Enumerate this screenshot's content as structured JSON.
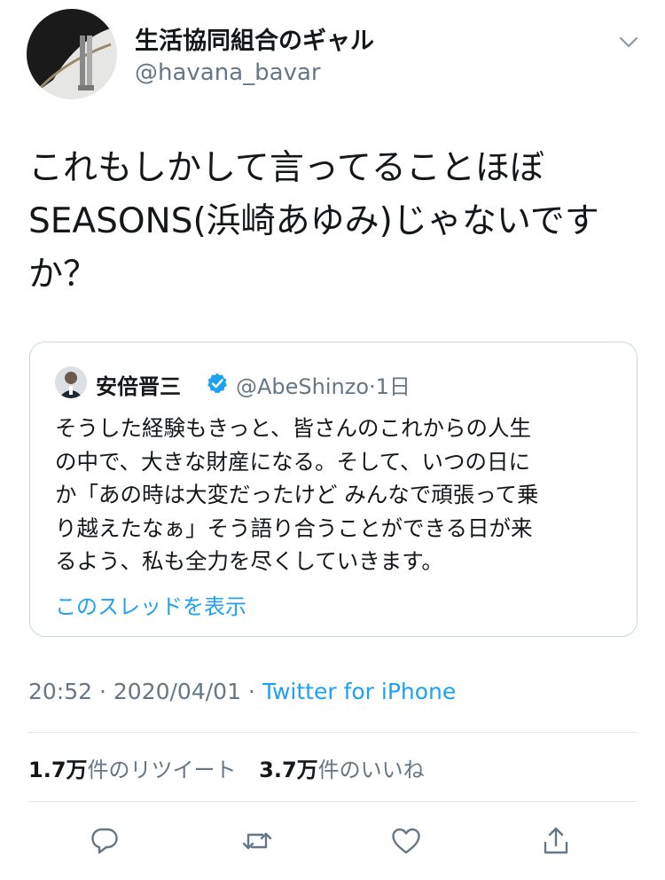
{
  "tweet": {
    "display_name": "生活協同組合のギャル",
    "handle": "@havana_bavar",
    "text_lines": [
      "これもしかして言ってることほぼ",
      "SEASONS(浜崎あゆみ)じゃないです",
      "か？"
    ],
    "time": "20:52",
    "date": "2020/04/01",
    "separator": " · ",
    "source": "Twitter for iPhone"
  },
  "quoted": {
    "display_name": "安倍晋三",
    "handle": "@AbeShinzo",
    "age": "·1日",
    "text_lines": [
      "そうした経験もきっと、皆さんのこれからの人生",
      "の中で、大きな財産になる。そして、いつの日に",
      "か「あの時は大変だったけど みんなで頑張って乗",
      "り越えたなぁ」そう語り合うことができる日が来",
      "るよう、私も全力を尽くしていきます。"
    ],
    "show_thread": "このスレッドを表示"
  },
  "stats": {
    "retweet_count": "1.7万",
    "retweet_label": "件のリツイート",
    "like_count": "3.7万",
    "like_label": "件のいいね"
  },
  "actions": {
    "icons": [
      "reply-icon",
      "retweet-icon",
      "like-icon",
      "share-icon"
    ]
  },
  "colors": {
    "text": "#14171a",
    "secondary": "#657786",
    "accent": "#1da1f2",
    "border": "#ccd6dd"
  }
}
